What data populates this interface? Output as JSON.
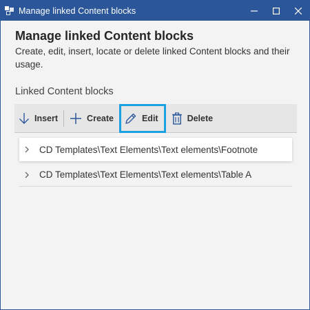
{
  "window": {
    "title": "Manage linked Content blocks",
    "icon": "app-logo-icon",
    "accent_color": "#2b579a",
    "controls": [
      "minimize-icon",
      "maximize-icon",
      "close-icon"
    ]
  },
  "dialog": {
    "heading": "Manage linked Content blocks",
    "description": "Create, edit, insert, locate or delete linked Content blocks and their usage.",
    "section_label": "Linked Content blocks"
  },
  "toolbar": {
    "insert_label": "Insert",
    "create_label": "Create",
    "edit_label": "Edit",
    "delete_label": "Delete",
    "highlight_color": "#1ba1e2"
  },
  "list": {
    "items": [
      {
        "label": "CD Templates\\Text Elements\\Text elements\\Footnote",
        "selected": true
      },
      {
        "label": "CD Templates\\Text Elements\\Text elements\\Table A",
        "selected": false
      }
    ]
  }
}
